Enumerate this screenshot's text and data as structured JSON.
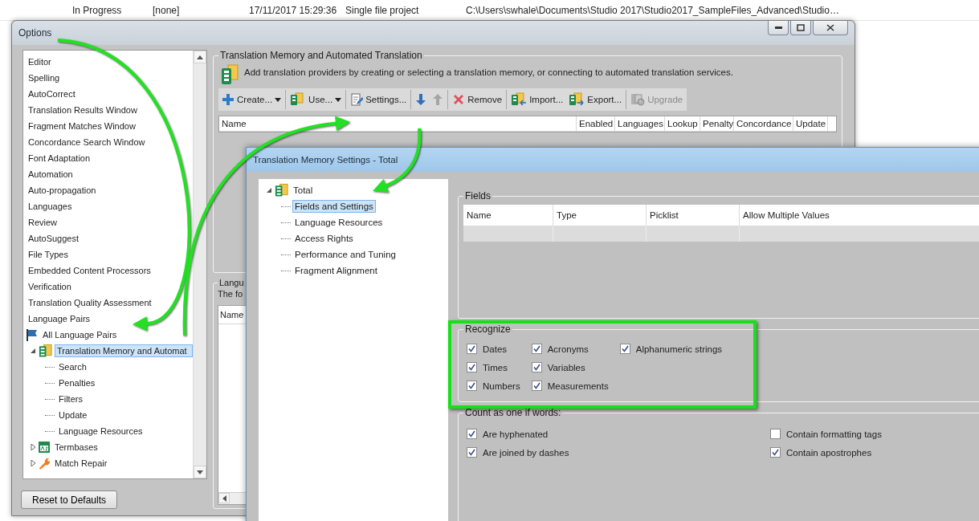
{
  "background_row": {
    "cells": [
      "In Progress",
      "[none]",
      "17/11/2017 15:29:36",
      "Single file project",
      "C:\\Users\\swhale\\Documents\\Studio  2017\\Studio2017_SampleFiles_Advanced\\Studio…"
    ]
  },
  "options": {
    "title": "Options",
    "tree": [
      {
        "label": "Editor",
        "selected": false
      },
      {
        "label": "Spelling",
        "selected": false
      },
      {
        "label": "AutoCorrect",
        "selected": false
      },
      {
        "label": "Translation Results Window",
        "selected": false
      },
      {
        "label": "Fragment Matches Window",
        "selected": false
      },
      {
        "label": "Concordance Search Window",
        "selected": false
      },
      {
        "label": "Font Adaptation",
        "selected": false
      },
      {
        "label": "Automation",
        "selected": false
      },
      {
        "label": "Auto-propagation",
        "selected": false
      },
      {
        "label": "Languages",
        "selected": false
      },
      {
        "label": "Review",
        "selected": false
      },
      {
        "label": "AutoSuggest",
        "selected": false
      },
      {
        "label": "File Types",
        "selected": false
      },
      {
        "label": "Embedded Content Processors",
        "selected": false
      },
      {
        "label": "Verification",
        "selected": false
      },
      {
        "label": "Translation Quality Assessment",
        "selected": false
      },
      {
        "label": "Language Pairs",
        "selected": false
      },
      {
        "label": "All Language Pairs",
        "kind": "flag",
        "selected": false,
        "children": [
          {
            "label": "Translation Memory and Automat",
            "kind": "tm",
            "expanded": true,
            "selected": true,
            "children": [
              {
                "label": "Search",
                "selected": false
              },
              {
                "label": "Penalties",
                "selected": false
              },
              {
                "label": "Filters",
                "selected": false
              },
              {
                "label": "Update",
                "selected": false
              },
              {
                "label": "Language Resources",
                "selected": false
              }
            ]
          },
          {
            "label": "Termbases",
            "kind": "termbase",
            "expanded": false,
            "selected": false
          },
          {
            "label": "Match Repair",
            "kind": "repair",
            "expanded": false,
            "selected": false
          }
        ]
      }
    ],
    "reset_button": "Reset to Defaults",
    "tm_group": {
      "title": "Translation Memory and Automated Translation",
      "description": "Add translation providers by creating or selecting a translation memory, or connecting to automated translation services.",
      "toolbar": [
        {
          "kind": "create",
          "label": "Create...",
          "dropdown": true,
          "disabled": false,
          "separator": true
        },
        {
          "kind": "use",
          "label": "Use...",
          "dropdown": true,
          "disabled": false,
          "separator": true
        },
        {
          "kind": "settings",
          "label": "Settings...",
          "dropdown": false,
          "disabled": false,
          "separator": true
        },
        {
          "kind": "down",
          "dropdown": false,
          "disabled": false,
          "separator": false
        },
        {
          "kind": "up",
          "dropdown": false,
          "disabled": true,
          "separator": true
        },
        {
          "kind": "remove",
          "label": "Remove",
          "dropdown": false,
          "disabled": false,
          "separator": true
        },
        {
          "kind": "import",
          "label": "Import...",
          "dropdown": false,
          "disabled": false,
          "separator": false
        },
        {
          "kind": "export",
          "label": "Export...",
          "dropdown": false,
          "disabled": false,
          "separator": true
        },
        {
          "kind": "upgrade",
          "label": "Upgrade",
          "dropdown": false,
          "disabled": true,
          "separator": false
        }
      ],
      "columns": [
        "Name",
        "Enabled",
        "Languages",
        "Lookup",
        "Penalty",
        "Concordance",
        "Update"
      ]
    },
    "language_group": {
      "title": "Langu",
      "text": "The fo",
      "column": "Name"
    }
  },
  "settings_dialog": {
    "title": "Translation Memory Settings - Total",
    "tree": [
      {
        "label": "Total",
        "kind": "tm",
        "expanded": true,
        "selected": false,
        "children": [
          {
            "label": "Fields and Settings",
            "selected": true
          },
          {
            "label": "Language Resources",
            "selected": false
          },
          {
            "label": "Access Rights",
            "selected": false
          },
          {
            "label": "Performance and Tuning",
            "selected": false
          },
          {
            "label": "Fragment Alignment",
            "selected": false
          }
        ]
      }
    ],
    "fields": {
      "title": "Fields",
      "columns": [
        "Name",
        "Type",
        "Picklist",
        "Allow Multiple Values"
      ]
    },
    "recognize": {
      "title": "Recognize",
      "options": [
        {
          "label": "Dates",
          "checked": true
        },
        {
          "label": "Times",
          "checked": true
        },
        {
          "label": "Numbers",
          "checked": true
        },
        {
          "label": "Acronyms",
          "checked": true
        },
        {
          "label": "Variables",
          "checked": true
        },
        {
          "label": "Measurements",
          "checked": true
        },
        {
          "label": "Alphanumeric strings",
          "checked": true
        }
      ]
    },
    "count_as_one": {
      "title": "Count as one if words:",
      "options": [
        {
          "label": "Are hyphenated",
          "checked": true
        },
        {
          "label": "Are joined by dashes",
          "checked": true
        },
        {
          "label": "Contain formatting tags",
          "checked": false
        },
        {
          "label": "Contain apostrophes",
          "checked": true
        }
      ]
    }
  }
}
